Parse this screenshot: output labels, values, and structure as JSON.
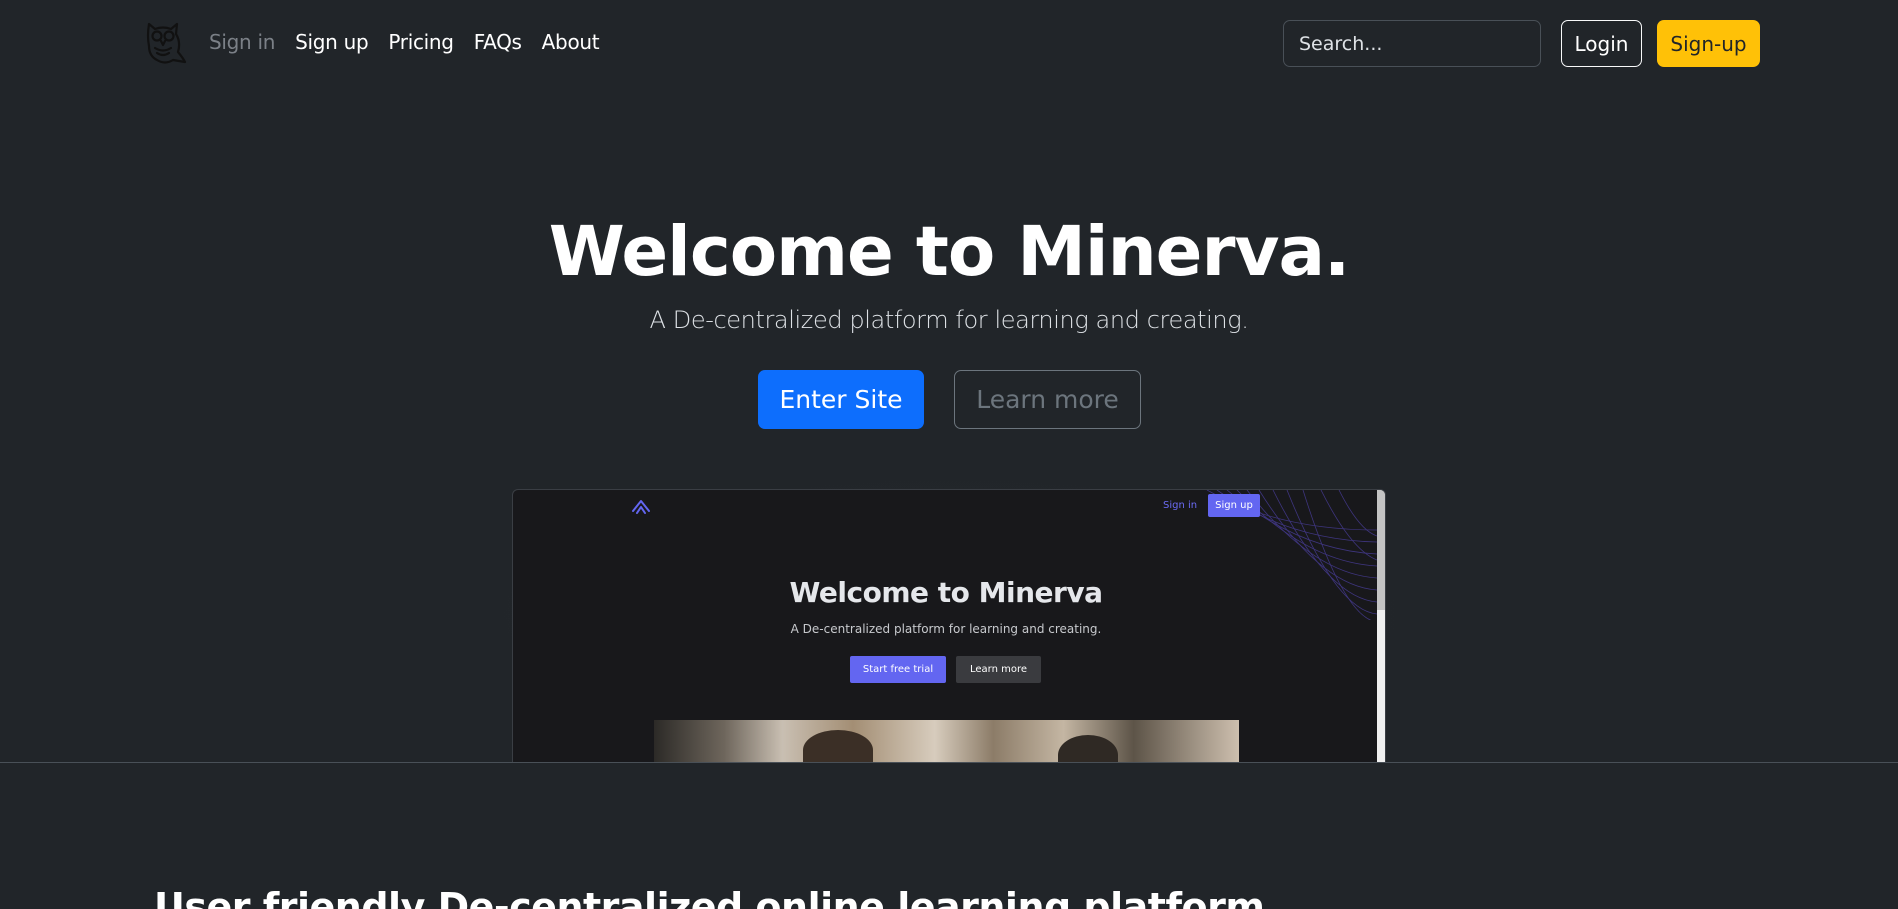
{
  "nav": {
    "logo_icon": "owl-icon",
    "links": [
      {
        "label": "Sign in",
        "muted": true
      },
      {
        "label": "Sign up",
        "muted": false
      },
      {
        "label": "Pricing",
        "muted": false
      },
      {
        "label": "FAQs",
        "muted": false
      },
      {
        "label": "About",
        "muted": false
      }
    ],
    "search_placeholder": "Search...",
    "login_label": "Login",
    "signup_label": "Sign-up"
  },
  "hero": {
    "title": "Welcome to Minerva.",
    "subtitle": "A De-centralized platform for learning and creating.",
    "primary_button": "Enter Site",
    "secondary_button": "Learn more"
  },
  "preview": {
    "logo_icon": "minerva-chevron-icon",
    "signin_label": "Sign in",
    "signup_label": "Sign up",
    "title": "Welcome to Minerva",
    "subtitle": "A De-centralized platform for learning and creating.",
    "primary_button": "Start free trial",
    "secondary_button": "Learn more"
  },
  "section": {
    "title": "User friendly De-centralized online learning platform"
  },
  "colors": {
    "background": "#212529",
    "primary": "#0d6efd",
    "warning": "#ffc107",
    "preview_accent": "#6366f1"
  }
}
